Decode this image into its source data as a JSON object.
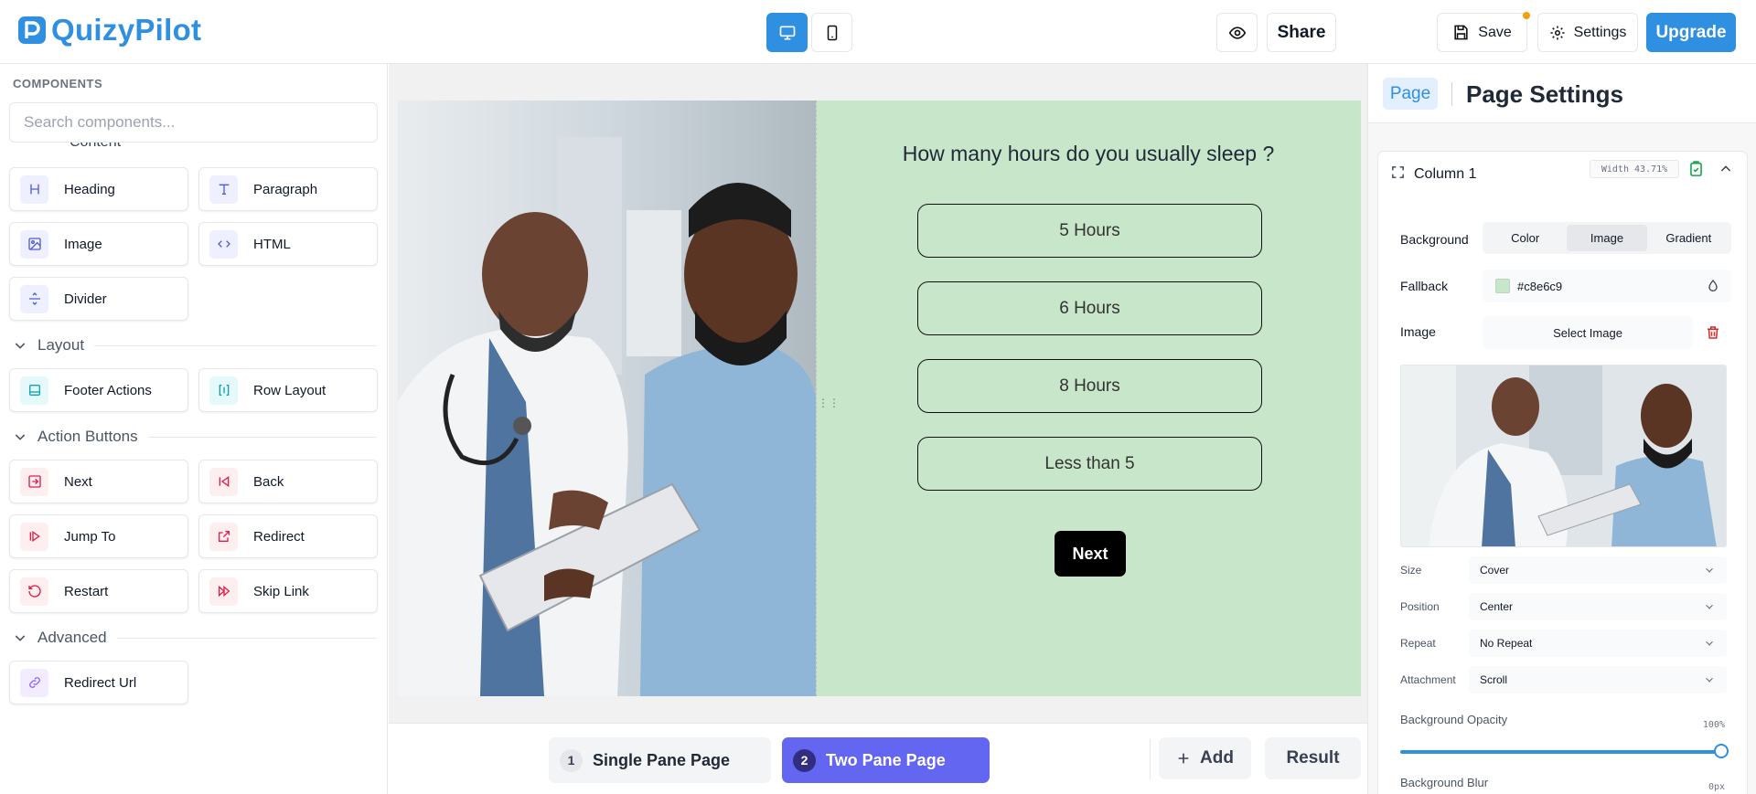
{
  "app": {
    "logo_text": "QuizyPilot",
    "accent_color": "#2f8fe0"
  },
  "topbar": {
    "device_buttons": [
      "desktop-icon",
      "mobile-icon"
    ],
    "share_label": "Share",
    "save_label": "Save",
    "settings_label": "Settings",
    "upgrade_label": "Upgrade"
  },
  "sidebar": {
    "title": "COMPONENTS",
    "search_placeholder": "Search components...",
    "clipped_section": "Content",
    "content_items": [
      {
        "label": "Heading",
        "icon": "heading-icon"
      },
      {
        "label": "Paragraph",
        "icon": "paragraph-icon"
      },
      {
        "label": "Image",
        "icon": "image-icon"
      },
      {
        "label": "HTML",
        "icon": "code-icon"
      },
      {
        "label": "Divider",
        "icon": "divider-icon"
      }
    ],
    "layout": {
      "label": "Layout",
      "items": [
        {
          "label": "Footer Actions",
          "icon": "footer-icon"
        },
        {
          "label": "Row Layout",
          "icon": "columns-icon"
        }
      ]
    },
    "action_buttons": {
      "label": "Action Buttons",
      "items": [
        {
          "label": "Next",
          "icon": "arrow-right-box-icon"
        },
        {
          "label": "Back",
          "icon": "skip-back-icon"
        },
        {
          "label": "Jump To",
          "icon": "jump-icon"
        },
        {
          "label": "Redirect",
          "icon": "external-link-icon"
        },
        {
          "label": "Restart",
          "icon": "restart-icon"
        },
        {
          "label": "Skip Link",
          "icon": "fast-forward-icon"
        }
      ]
    },
    "advanced": {
      "label": "Advanced",
      "items": [
        {
          "label": "Redirect Url",
          "icon": "link-icon"
        }
      ]
    }
  },
  "canvas": {
    "question": "How  many hours do you usually sleep ?",
    "options": [
      "5 Hours",
      "6 Hours",
      "8 Hours",
      "Less than 5"
    ],
    "next_label": "Next",
    "background_color": "#c8e6c9"
  },
  "bottom_bar": {
    "pages": [
      {
        "num": "1",
        "label": "Single Pane Page",
        "active": false
      },
      {
        "num": "2",
        "label": "Two Pane Page",
        "active": true
      }
    ],
    "add_label": "Add",
    "result_label": "Result"
  },
  "panel": {
    "tab_label": "Page",
    "title": "Page Settings",
    "column_title": "Column 1",
    "width_tag": "Width 43.71%",
    "background_label": "Background",
    "bg_options": [
      "Color",
      "Image",
      "Gradient"
    ],
    "bg_selected": "Image",
    "fallback_label": "Fallback",
    "fallback_value": "#c8e6c9",
    "image_label": "Image",
    "select_image_label": "Select Image",
    "size_label": "Size",
    "size_value": "Cover",
    "position_label": "Position",
    "position_value": "Center",
    "repeat_label": "Repeat",
    "repeat_value": "No Repeat",
    "attachment_label": "Attachment",
    "attachment_value": "Scroll",
    "opacity_label": "Background Opacity",
    "opacity_value": "100%",
    "opacity_fraction": 1.0,
    "blur_label": "Background Blur",
    "blur_value": "0px"
  }
}
